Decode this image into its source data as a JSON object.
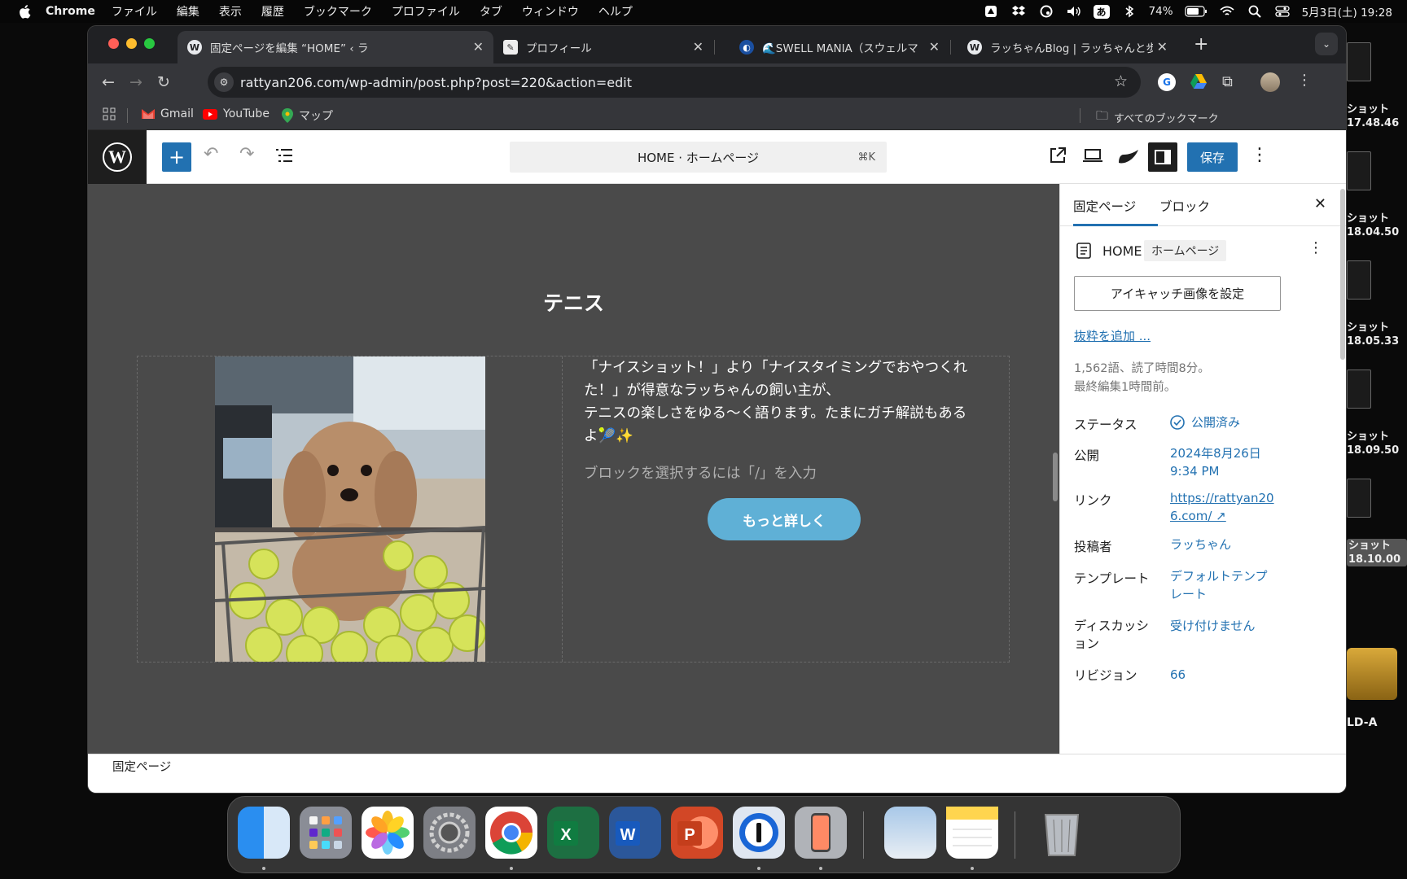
{
  "menubar": {
    "app": "Chrome",
    "items": [
      "ファイル",
      "編集",
      "表示",
      "履歴",
      "ブックマーク",
      "プロファイル",
      "タブ",
      "ウィンドウ",
      "ヘルプ"
    ],
    "input_mode": "あ",
    "battery": "74%",
    "datetime": "5月3日(土) 19:28"
  },
  "desktop": {
    "items": [
      {
        "line1": "ショット",
        "line2": "17.48.46"
      },
      {
        "line1": "ショット",
        "line2": "18.04.50"
      },
      {
        "line1": "ショット",
        "line2": "18.05.33"
      },
      {
        "line1": "ショット",
        "line2": "18.09.50"
      },
      {
        "line1": "ショット",
        "line2": "18.10.00"
      }
    ],
    "drive_label": "LD-A"
  },
  "browser": {
    "tabs": [
      {
        "title": "固定ページを編集 “HOME” ‹ ラ",
        "icon": "wordpress-icon"
      },
      {
        "title": "プロフィール",
        "icon": "profile-icon"
      },
      {
        "title": "🌊SWELL MANIA（スウェルマ",
        "icon": "swell-icon"
      },
      {
        "title": "ラッちゃんBlog | ラッちゃんと歩",
        "icon": "wordpress-icon"
      }
    ],
    "url": "rattyan206.com/wp-admin/post.php?post=220&action=edit",
    "bookmarks": [
      "Gmail",
      "YouTube",
      "マップ"
    ],
    "all_bookmarks": "すべてのブックマーク"
  },
  "editor": {
    "command_bar": "HOME · ホームページ",
    "shortcut": "⌘K",
    "save_label": "保存",
    "heading": "テニス",
    "paragraph_1": "「ナイスショット！」より「ナイスタイミングでおやつくれた！」が得意なラッちゃんの飼い主が、",
    "paragraph_2": "テニスの楽しさをゆる〜く語ります。たまにガチ解説もあるよ🎾✨",
    "placeholder": "ブロックを選択するには「/」を入力",
    "button": "もっと詳しく",
    "breadcrumb": "固定ページ"
  },
  "sidebar": {
    "tabs": [
      "固定ページ",
      "ブロック"
    ],
    "page_title": "HOME",
    "page_badge": "ホームページ",
    "featured_image": "アイキャッチ画像を設定",
    "excerpt_link": "抜粋を追加 ...",
    "stats": "1,562語、読了時間8分。",
    "last_edited": "最終編集1時間前。",
    "rows": [
      {
        "label": "ステータス",
        "value": "公開済み"
      },
      {
        "label": "公開",
        "value": "2024年8月26日 9:34 PM"
      },
      {
        "label": "リンク",
        "value": "https://rattyan206.com/ ↗"
      },
      {
        "label": "投稿者",
        "value": "ラッちゃん"
      },
      {
        "label": "テンプレート",
        "value": "デフォルトテンプレート"
      },
      {
        "label": "ディスカッション",
        "value": "受け付けません"
      },
      {
        "label": "リビジョン",
        "value": "66"
      }
    ]
  },
  "dock": {
    "apps": [
      "Finder",
      "Launchpad",
      "Photos",
      "System Settings",
      "Chrome",
      "Excel",
      "Word",
      "PowerPoint",
      "1Password",
      "iPhone Mirroring",
      "Preview",
      "Notes",
      "Trash"
    ]
  }
}
